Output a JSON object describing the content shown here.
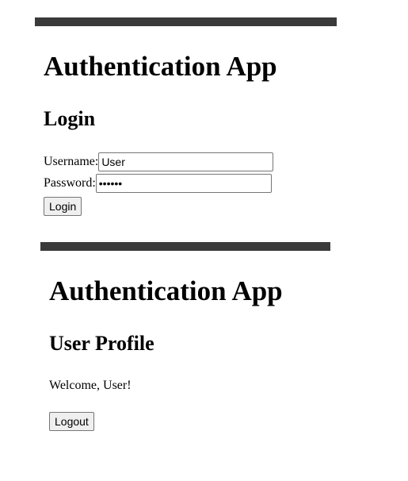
{
  "app_title": "Authentication App",
  "login": {
    "heading": "Login",
    "username_label": "Username:",
    "username_value": "User",
    "password_label": "Password:",
    "password_value": "••••••",
    "submit_label": "Login"
  },
  "profile": {
    "heading": "User Profile",
    "welcome_text": "Welcome, User!",
    "logout_label": "Logout"
  }
}
